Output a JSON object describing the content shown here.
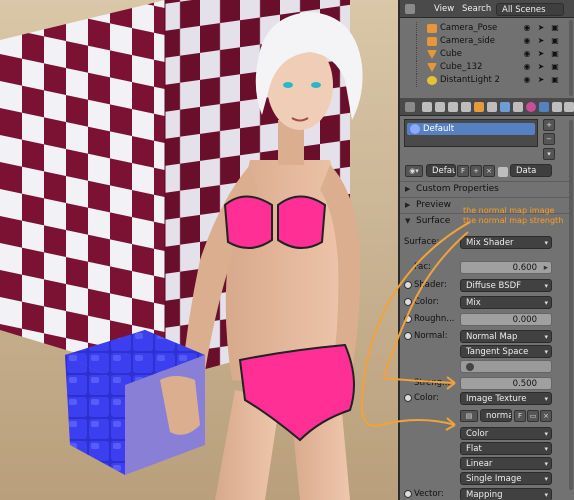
{
  "outliner_header": {
    "view": "View",
    "search": "Search",
    "scene_filter": "All Scenes"
  },
  "outliner": {
    "items": [
      {
        "name": "Camera_Pose",
        "icon": "camera-icon"
      },
      {
        "name": "Camera_side",
        "icon": "camera-icon"
      },
      {
        "name": "Cube",
        "icon": "mesh-icon"
      },
      {
        "name": "Cube_132",
        "icon": "mesh-icon"
      },
      {
        "name": "DistantLight 2",
        "icon": "light-icon"
      }
    ]
  },
  "material": {
    "slot_name": "Default",
    "datablock_name": "Defaul",
    "fake_user": "F",
    "data_mode": "Data"
  },
  "sections": {
    "custom_properties": "Custom Properties",
    "preview": "Preview",
    "surface": "Surface"
  },
  "annotations": {
    "line1": "the normal map image",
    "line2": "the normal map strength"
  },
  "surface": {
    "surface_label": "Surface:",
    "surface_value": "Mix Shader",
    "fac_label": "Fac:",
    "fac_value": "0.600",
    "shader_label": "Shader:",
    "shader_value": "Diffuse BSDF",
    "color_label": "Color:",
    "color_value": "Mix",
    "roughness_label": "Roughn...",
    "roughness_value": "0.000",
    "normal_label": "Normal:",
    "normal_value": "Normal Map",
    "space_value": "Tangent Space",
    "strength_label": "Streng...",
    "strength_value": "0.500",
    "color2_label": "Color:",
    "color2_value": "Image Texture",
    "image_name": "normal",
    "image_fake_user": "F",
    "color_space": "Color",
    "projection": "Flat",
    "interpolation": "Linear",
    "source": "Single Image",
    "vector_label": "Vector:",
    "vector_value": "Mapping"
  }
}
